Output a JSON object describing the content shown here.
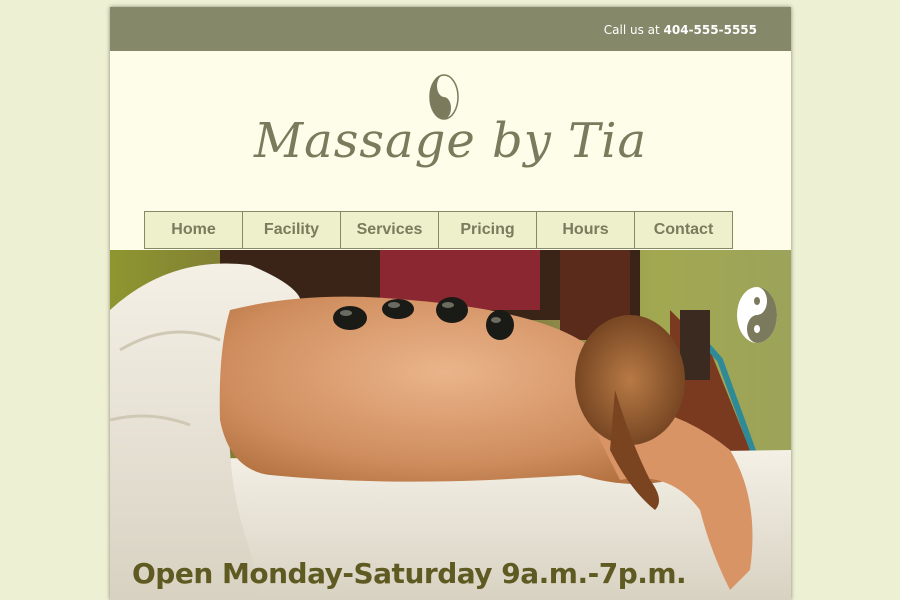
{
  "header": {
    "call_prefix": "Call us at",
    "phone": "404-555-5555",
    "logo_text": "Massage by Tia"
  },
  "nav": {
    "items": [
      "Home",
      "Facility",
      "Services",
      "Pricing",
      "Hours",
      "Contact"
    ]
  },
  "hero": {
    "hours_text": "Open Monday-Saturday 9a.m.-7p.m."
  },
  "colors": {
    "background": "#eef0d4",
    "topbar": "#86886a",
    "panel": "#fdfde9",
    "nav_bg": "#edf0cb",
    "accent_text": "#7c7a5c"
  }
}
